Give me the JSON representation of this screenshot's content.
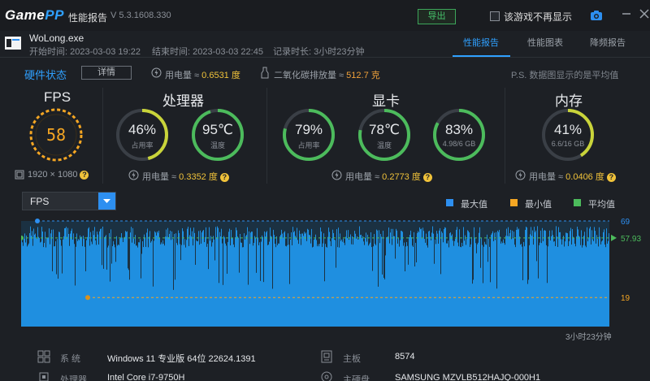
{
  "titlebar": {
    "logo_game": "Game",
    "logo_pp": "PP",
    "title": "性能报告",
    "version": "V 5.3.1608.330",
    "export_label": "导出",
    "hide_label": "该游戏不再显示"
  },
  "header": {
    "app_name": "WoLong.exe",
    "start_time": "开始时间: 2023-03-03 19:22",
    "end_time": "结束时间: 2023-03-03 22:45",
    "duration": "记录时长: 3小时23分钟",
    "tabs": [
      "性能报告",
      "性能图表",
      "降频报告"
    ]
  },
  "hardware": {
    "title": "硬件状态",
    "detail_label": "详情",
    "power_label": "用电量 ≈ ",
    "power_value": "0.6531 度",
    "co2_label": "二氧化碳排放量 ≈ ",
    "co2_value": "512.7 克",
    "note": "P.S. 数据图显示的是平均值"
  },
  "sections": {
    "fps": {
      "title": "FPS",
      "value": "58",
      "resolution": "1920 × 1080"
    },
    "cpu": {
      "title": "处理器",
      "usage_value": "46%",
      "usage_label": "占用率",
      "usage_pct": 46,
      "temp_value": "95℃",
      "temp_label": "温度",
      "temp_pct": 95,
      "power_label": "用电量 ≈ ",
      "power_value": "0.3352 度"
    },
    "gpu": {
      "title": "显卡",
      "usage_value": "79%",
      "usage_label": "占用率",
      "usage_pct": 79,
      "temp_value": "78℃",
      "temp_label": "温度",
      "temp_pct": 78,
      "mem_value": "83%",
      "mem_label": "4.98/6 GB",
      "mem_pct": 83,
      "power_label": "用电量 ≈ ",
      "power_value": "0.2773 度"
    },
    "ram": {
      "title": "内存",
      "usage_value": "41%",
      "usage_label": "6.6/16 GB",
      "usage_pct": 41,
      "power_label": "用电量 ≈ ",
      "power_value": "0.0406 度"
    }
  },
  "chart": {
    "metric": "FPS",
    "legend": [
      {
        "label": "最大值",
        "color": "#2d8ff0"
      },
      {
        "label": "最小值",
        "color": "#f5a623"
      },
      {
        "label": "平均值",
        "color": "#4cbb5c"
      }
    ],
    "duration_label": "3小时23分钟"
  },
  "chart_data": {
    "type": "area",
    "title": "",
    "xlabel": "",
    "ylabel": "",
    "series": [
      {
        "name": "FPS",
        "summary": {
          "max": 69,
          "min": 19,
          "avg": 57.93
        }
      }
    ],
    "max_label": "69",
    "min_label": "19",
    "avg_label": "57.93",
    "ylim": [
      0,
      69
    ]
  },
  "system": [
    {
      "label": "系  统",
      "value": "Windows 11 专业版 64位 22624.1391",
      "icon": "windows-icon"
    },
    {
      "label": "主板",
      "value": "8574",
      "icon": "motherboard-icon"
    },
    {
      "label": "处理器",
      "value": "Intel Core i7-9750H",
      "icon": "cpu-icon"
    },
    {
      "label": "主硬盘",
      "value": "SAMSUNG MZVLB512HAJQ-000H1",
      "icon": "disk-icon"
    }
  ],
  "colors": {
    "accent": "#2fa0ff",
    "fps": "#f5a623",
    "gauge_green": "#4cbb5c",
    "gauge_yellow": "#c9d43a",
    "bar": "#1f8fe0"
  }
}
